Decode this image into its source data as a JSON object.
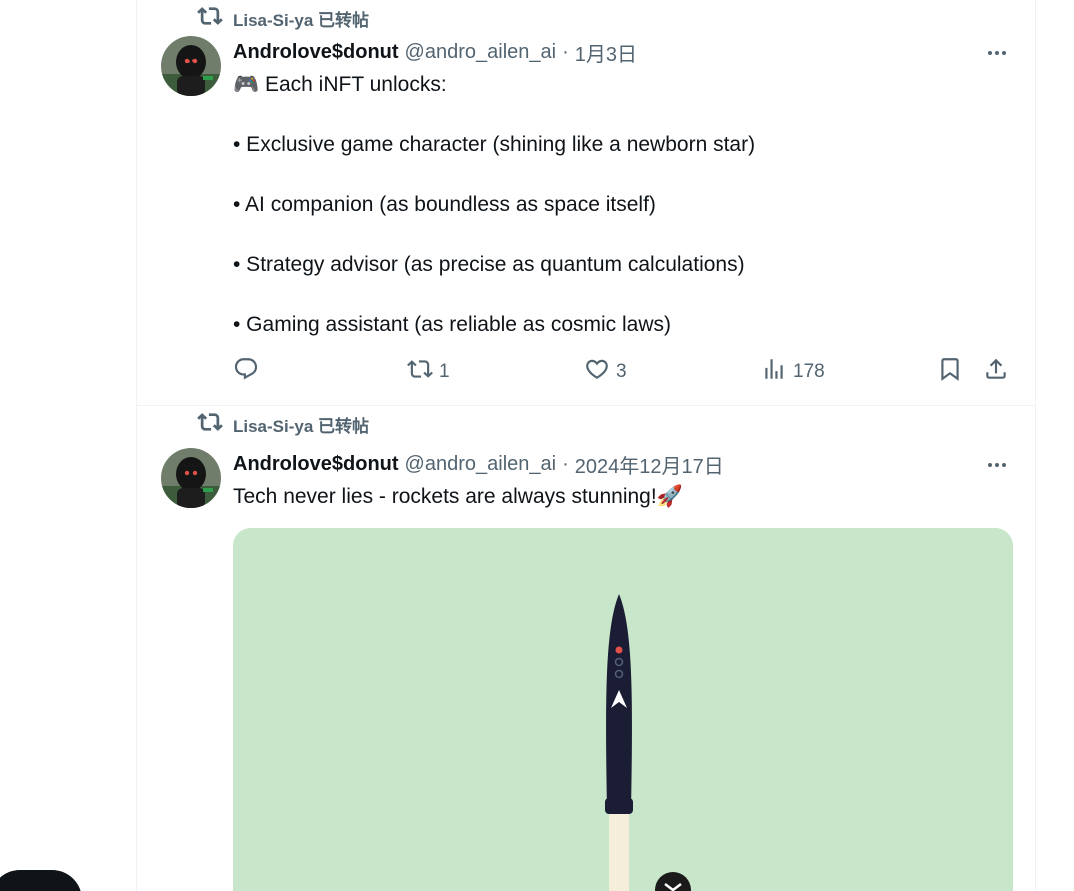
{
  "tweets": [
    {
      "repost_by": "Lisa-Si-ya 已转帖",
      "author_name": "Androlove$donut",
      "handle": "@andro_ailen_ai",
      "sep": "·",
      "date": "1月3日",
      "lines": [
        "🎮 Each iNFT unlocks:",
        "",
        "• Exclusive game character (shining like a newborn star)",
        "",
        "• AI companion (as boundless as space itself)",
        "",
        "• Strategy advisor (as precise as quantum calculations)",
        "",
        "• Gaming assistant (as reliable as cosmic laws)"
      ],
      "actions": {
        "reply_count": "",
        "repost_count": "1",
        "like_count": "3",
        "views_count": "178"
      }
    },
    {
      "repost_by": "Lisa-Si-ya 已转帖",
      "author_name": "Androlove$donut",
      "handle": "@andro_ailen_ai",
      "sep": "·",
      "date": "2024年12月17日",
      "text": "Tech never lies - rockets are always stunning!🚀"
    }
  ],
  "icons": [
    "repost-icon",
    "more-icon",
    "reply-icon",
    "like-icon",
    "views-icon",
    "bookmark-icon",
    "share-icon",
    "rocket-image"
  ],
  "colors": {
    "text": "#0f1419",
    "muted": "#536471",
    "divider": "#eff3f4",
    "media_bg": "#c8e6c9",
    "rocket": "#1a1d33"
  }
}
